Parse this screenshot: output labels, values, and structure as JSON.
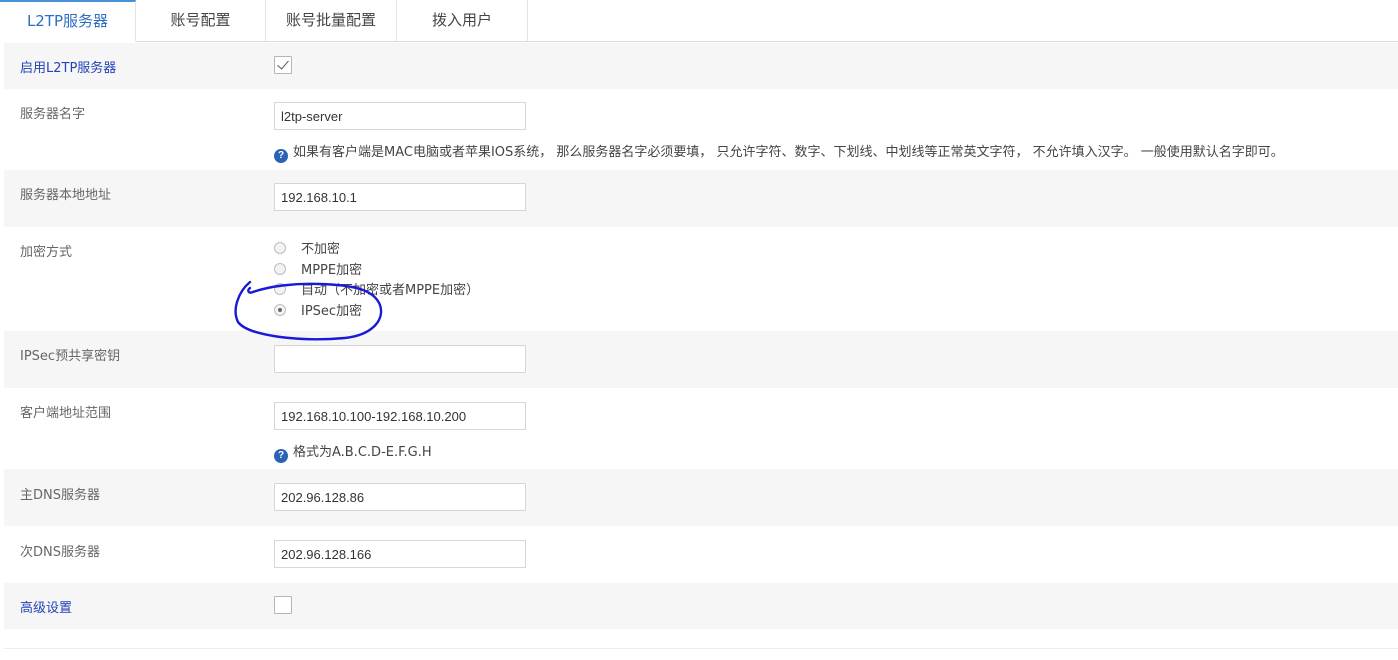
{
  "tabs": [
    {
      "label": "L2TP服务器",
      "active": true
    },
    {
      "label": "账号配置",
      "active": false
    },
    {
      "label": "账号批量配置",
      "active": false
    },
    {
      "label": "拨入用户",
      "active": false
    }
  ],
  "enable": {
    "label": "启用L2TP服务器",
    "checked": true
  },
  "server_name": {
    "label": "服务器名字",
    "value": "l2tp-server",
    "help": "如果有客户端是MAC电脑或者苹果IOS系统， 那么服务器名字必须要填， 只允许字符、数字、下划线、中划线等正常英文字符， 不允许填入汉字。 一般使用默认名字即可。"
  },
  "local_addr": {
    "label": "服务器本地地址",
    "value": "192.168.10.1"
  },
  "encryption": {
    "label": "加密方式",
    "options": [
      "不加密",
      "MPPE加密",
      "自动（不加密或者MPPE加密）",
      "IPSec加密"
    ],
    "selected": "IPSec加密"
  },
  "psk": {
    "label": "IPSec预共享密钥",
    "value": ""
  },
  "client_range": {
    "label": "客户端地址范围",
    "value": "192.168.10.100-192.168.10.200",
    "help": "格式为A.B.C.D-E.F.G.H"
  },
  "dns1": {
    "label": "主DNS服务器",
    "value": "202.96.128.86"
  },
  "dns2": {
    "label": "次DNS服务器",
    "value": "202.96.128.166"
  },
  "advanced": {
    "label": "高级设置",
    "checked": false
  },
  "icons": {
    "help": "question-circle-icon",
    "check": "checkmark-icon"
  },
  "colors": {
    "accent": "#2b6fc2",
    "label_link": "#2243b8",
    "row_alt": "#f6f6f6",
    "annotation": "#1a1ad6"
  }
}
